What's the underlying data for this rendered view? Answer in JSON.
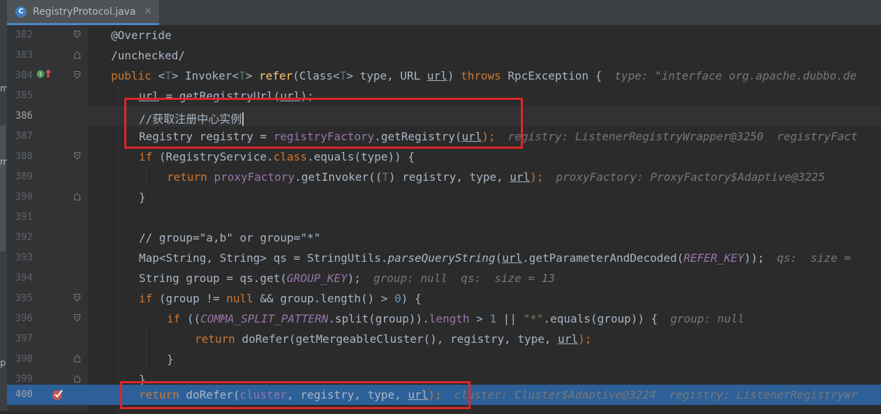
{
  "tab": {
    "icon_letter": "C",
    "title": "RegistryProtocol.java",
    "close": "✕"
  },
  "left_strip": {
    "letters": [
      "m",
      "m",
      "p"
    ]
  },
  "lines": [
    {
      "n": "382",
      "text": "@Override"
    },
    {
      "n": "383",
      "text": "/unchecked/"
    },
    {
      "n": "384",
      "text_parts": [
        "public",
        "<",
        "T",
        "> Invoker<",
        "T",
        "> ",
        "refer",
        "(Class<",
        "T",
        "> type, URL ",
        "url",
        ") ",
        "throws",
        " RpcException {"
      ],
      "hint": "type: \"interface org.apache.dubbo.de"
    },
    {
      "n": "385",
      "parts": [
        "url",
        " = getRegistryUrl(",
        "url",
        ");"
      ]
    },
    {
      "n": "386",
      "comment": "//获取注册中心实例"
    },
    {
      "n": "387",
      "parts": [
        "Registry registry = ",
        "registryFactory",
        ".getRegistry(",
        "url",
        ");"
      ],
      "hint": "registry: ListenerRegistryWrapper@3250  registryFact"
    },
    {
      "n": "388",
      "parts": [
        "if",
        " (RegistryService.",
        "class",
        ".equals(type)) {"
      ]
    },
    {
      "n": "389",
      "parts": [
        "return",
        " ",
        "proxyFactory",
        ".getInvoker((",
        "T",
        ") registry, type, ",
        "url",
        ");"
      ],
      "hint": "proxyFactory: ProxyFactory$Adaptive@3225"
    },
    {
      "n": "390",
      "parts": [
        "}"
      ]
    },
    {
      "n": "391",
      "parts": [
        ""
      ]
    },
    {
      "n": "392",
      "parts": [
        "// group=\"a,b\" or group=\"*\""
      ]
    },
    {
      "n": "393",
      "parts": [
        "Map<String, String> qs = StringUtils.",
        "parseQueryString",
        "(",
        "url",
        ".getParameterAndDecoded(",
        "REFER_KEY",
        "));"
      ],
      "hint": "qs:  size = "
    },
    {
      "n": "394",
      "parts": [
        "String group = qs.get(",
        "GROUP_KEY",
        ");"
      ],
      "hint": "group: null  qs:  size = 13"
    },
    {
      "n": "395",
      "parts": [
        "if",
        " (group != ",
        "null",
        " && group.length() > ",
        "0",
        ") {"
      ]
    },
    {
      "n": "396",
      "parts": [
        "if",
        " ((",
        "COMMA_SPLIT_PATTERN",
        ".split(group)).",
        "length",
        " > ",
        "1",
        " || ",
        "\"*\"",
        ".equals(group)) {"
      ],
      "hint": "group: null"
    },
    {
      "n": "397",
      "parts": [
        "return",
        " doRefer(getMergeableCluster(), registry, type, ",
        "url",
        ");"
      ]
    },
    {
      "n": "398",
      "parts": [
        "}"
      ]
    },
    {
      "n": "399",
      "parts": [
        "}"
      ]
    },
    {
      "n": "400",
      "parts": [
        "return",
        " doRefer(",
        "cluster",
        ", registry, type, ",
        "url",
        ");"
      ],
      "hint": "cluster: Cluster$Adaptive@3224  registry: ListenerRegistryWr"
    }
  ],
  "colors": {
    "box": "#e0262b",
    "exec_line": "#2d6099",
    "keyword": "#cc7832",
    "field": "#9876aa",
    "method": "#ffc66d"
  }
}
